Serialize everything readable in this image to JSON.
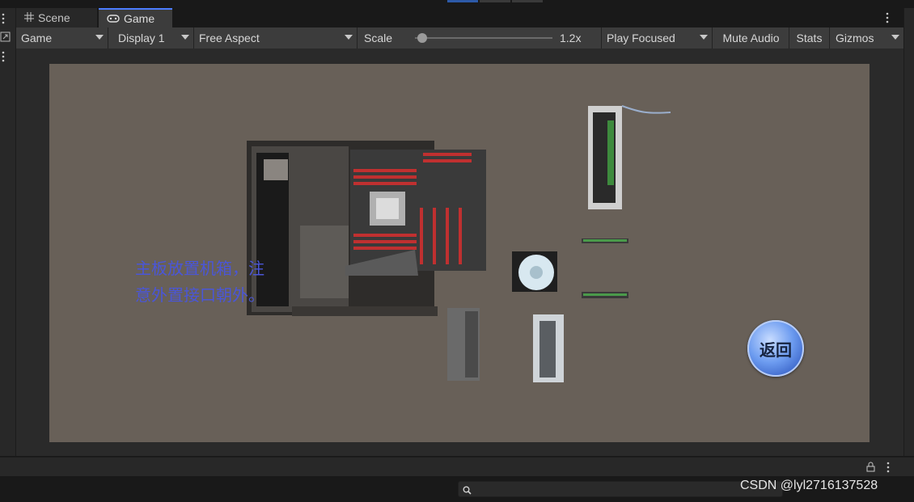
{
  "tabs": [
    {
      "label": "Scene",
      "icon": "grid-icon",
      "active": false
    },
    {
      "label": "Game",
      "icon": "gamepad-icon",
      "active": true
    }
  ],
  "toolbar": {
    "view_mode": "Game",
    "display": "Display 1",
    "aspect": "Free Aspect",
    "scale_label": "Scale",
    "scale_value": "1.2x",
    "scale_fraction": 0.05,
    "play_mode": "Play Focused",
    "mute_label": "Mute Audio",
    "stats_label": "Stats",
    "gizmos_label": "Gizmos"
  },
  "game": {
    "instruction": "主板放置机箱，注意外置接口朝外。",
    "instruction_line1": "主板放置机箱，注",
    "instruction_line2": "意外置接口朝外。",
    "return_label": "返回",
    "components": [
      "pc-case",
      "graphics-card",
      "ram-stick",
      "ram-stick",
      "cpu-cooler",
      "power-supply",
      "hard-drive"
    ]
  },
  "watermark": "CSDN @lyl2716137528",
  "colors": {
    "accent": "#4c7dff",
    "viewport_bg": "#686058",
    "instruction_text": "#4a56d8",
    "return_button": "#6d9cf0"
  }
}
